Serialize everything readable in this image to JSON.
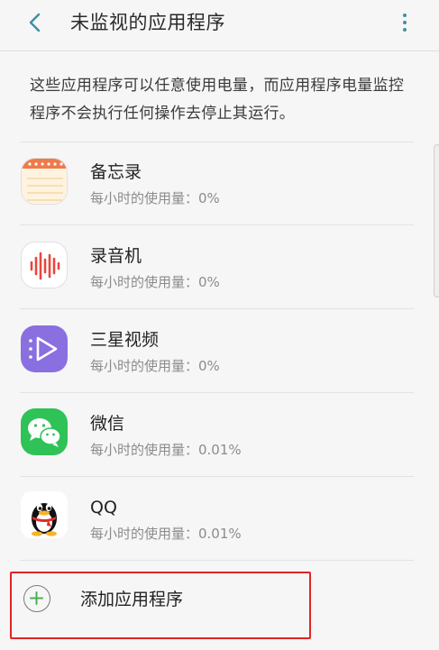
{
  "header": {
    "back_icon": "chevron-left-icon",
    "title": "未监视的应用程序",
    "more_icon": "vertical-dots-icon"
  },
  "description": "这些应用程序可以任意使用电量，而应用程序电量监控程序不会执行任何操作去停止其运行。",
  "apps": [
    {
      "name": "备忘录",
      "usage": "每小时的使用量：0%",
      "icon": "notes-icon"
    },
    {
      "name": "录音机",
      "usage": "每小时的使用量：0%",
      "icon": "voice-recorder-icon"
    },
    {
      "name": "三星视频",
      "usage": "每小时的使用量：0%",
      "icon": "samsung-video-icon"
    },
    {
      "name": "微信",
      "usage": "每小时的使用量：0.01%",
      "icon": "wechat-icon"
    },
    {
      "name": "QQ",
      "usage": "每小时的使用量：0.01%",
      "icon": "qq-penguin-icon"
    }
  ],
  "add_button": {
    "label": "添加应用程序",
    "icon": "plus-circle-icon"
  },
  "colors": {
    "accent": "#3e8fa4",
    "highlight_border": "#e02525",
    "plus_green": "#4bb04f",
    "video_purple": "#8a6fe0",
    "wechat_green": "#2fc257",
    "recorder_red": "#e8463e",
    "notes_orange": "#f07a4a"
  }
}
